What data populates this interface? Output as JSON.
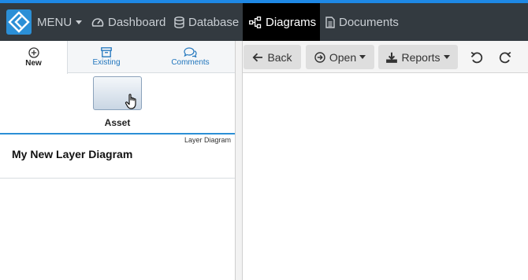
{
  "navbar": {
    "menu_label": "MENU",
    "items": [
      {
        "label": "Dashboard",
        "icon": "dashboard-icon"
      },
      {
        "label": "Database",
        "icon": "database-icon"
      },
      {
        "label": "Diagrams",
        "icon": "diagram-icon",
        "active": true
      },
      {
        "label": "Documents",
        "icon": "document-icon"
      }
    ]
  },
  "left_panel": {
    "tabs": [
      {
        "label": "New",
        "icon": "plus-circle-icon",
        "active": true
      },
      {
        "label": "Existing",
        "icon": "archive-icon"
      },
      {
        "label": "Comments",
        "icon": "comments-icon"
      }
    ],
    "palette": {
      "item_label": "Asset"
    },
    "layer": {
      "type": "Layer Diagram",
      "name": "My New Layer Diagram"
    }
  },
  "toolbar": {
    "back_label": "Back",
    "open_label": "Open",
    "reports_label": "Reports",
    "undo_icon": "undo-icon",
    "redo_icon": "redo-icon"
  },
  "colors": {
    "navbar_bg": "#333a40",
    "accent": "#2b8fd6",
    "active_nav_bg": "#000000",
    "tab_text": "#2176bd"
  }
}
